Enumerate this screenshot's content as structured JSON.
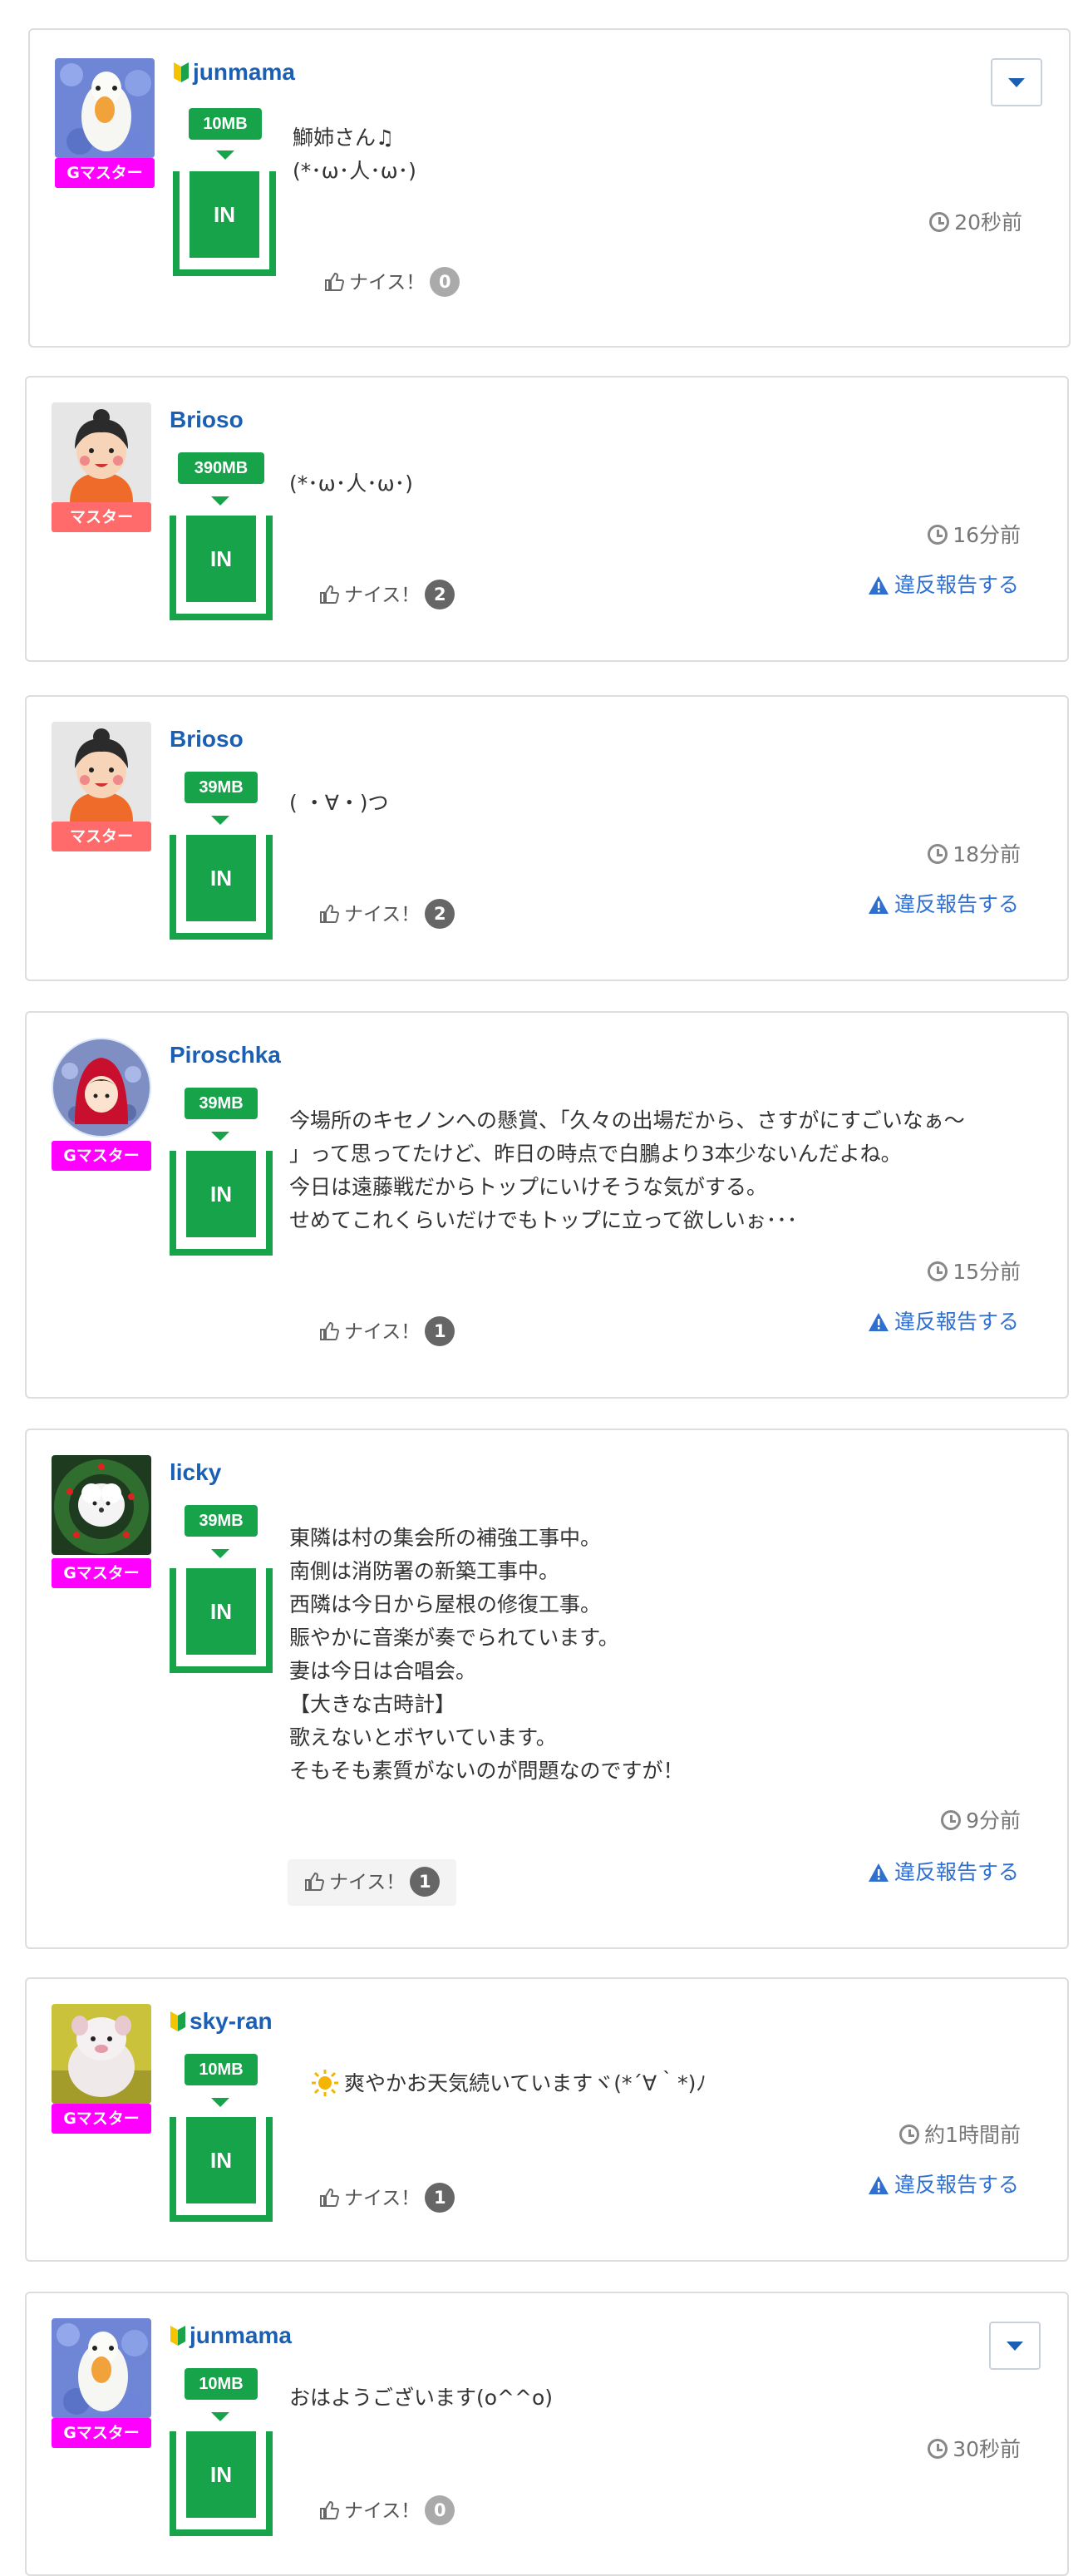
{
  "posts": [
    {
      "username": "junmama",
      "beginner": true,
      "rank": "Gマスター",
      "mb": "10MB",
      "in_label": "IN",
      "message": "鰤姉さん♫\n(*･ω･人･ω･)",
      "time": "20秒前",
      "like_label": "ナイス！",
      "likes": "0",
      "report": "",
      "menu": true,
      "avatar": "goose"
    },
    {
      "username": "Brioso",
      "beginner": false,
      "rank": "マスター",
      "mb": "390MB",
      "in_label": "IN",
      "message": "(*･ω･人･ω･)",
      "time": "16分前",
      "like_label": "ナイス！",
      "likes": "2",
      "report": "違反報告する",
      "menu": false,
      "avatar": "woman"
    },
    {
      "username": "Brioso",
      "beginner": false,
      "rank": "マスター",
      "mb": "39MB",
      "in_label": "IN",
      "message": "( ・∀・)つ",
      "time": "18分前",
      "like_label": "ナイス！",
      "likes": "2",
      "report": "違反報告する",
      "menu": false,
      "avatar": "woman"
    },
    {
      "username": "Piroschka",
      "beginner": false,
      "rank": "Gマスター",
      "mb": "39MB",
      "in_label": "IN",
      "message": "今場所のキセノンへの懸賞、「久々の出場だから、さすがにすごいなぁ〜\n」って思ってたけど、昨日の時点で白鵬より3本少ないんだよね。\n今日は遠藤戦だからトップにいけそうな気がする。\nせめてこれくらいだけでもトップに立って欲しいぉ･･･",
      "time": "15分前",
      "like_label": "ナイス！",
      "likes": "1",
      "report": "違反報告する",
      "menu": false,
      "avatar": "redhood"
    },
    {
      "username": "licky",
      "beginner": false,
      "rank": "Gマスター",
      "mb": "39MB",
      "in_label": "IN",
      "message": "東隣は村の集会所の補強工事中。\n南側は消防署の新築工事中。\n西隣は今日から屋根の修復工事。\n賑やかに音楽が奏でられています。\n妻は今日は合唱会。\n【大きな古時計】\n歌えないとボヤいています。\nそもそも素質がないのが問題なのですが！",
      "time": "9分前",
      "like_label": "ナイス！",
      "likes": "1",
      "report": "違反報告する",
      "menu": false,
      "avatar": "dogwreath"
    },
    {
      "username": "sky-ran",
      "beginner": true,
      "rank": "Gマスター",
      "mb": "10MB",
      "in_label": "IN",
      "message": "爽やかお天気続いていますヾ(*´∀｀*)ﾉ",
      "time": "約1時間前",
      "like_label": "ナイス！",
      "likes": "1",
      "report": "違反報告する",
      "menu": false,
      "avatar": "plush",
      "emoji": "sun"
    },
    {
      "username": "junmama",
      "beginner": true,
      "rank": "Gマスター",
      "mb": "10MB",
      "in_label": "IN",
      "message": "おはようございます(o^^o)",
      "time": "30秒前",
      "like_label": "ナイス！",
      "likes": "0",
      "report": "",
      "menu": true,
      "avatar": "goose"
    }
  ],
  "colors": {
    "link": "#1a5fb4",
    "green": "#16a34a",
    "gmaster": "#ff00ff",
    "master": "#ff6b6b",
    "report": "#2f6fd0"
  },
  "icons": {
    "clock": "clock-icon",
    "thumb": "thumbs-up-icon",
    "warning": "warning-icon",
    "beginner": "beginner-mark-icon",
    "menu": "chevron-down-icon"
  }
}
